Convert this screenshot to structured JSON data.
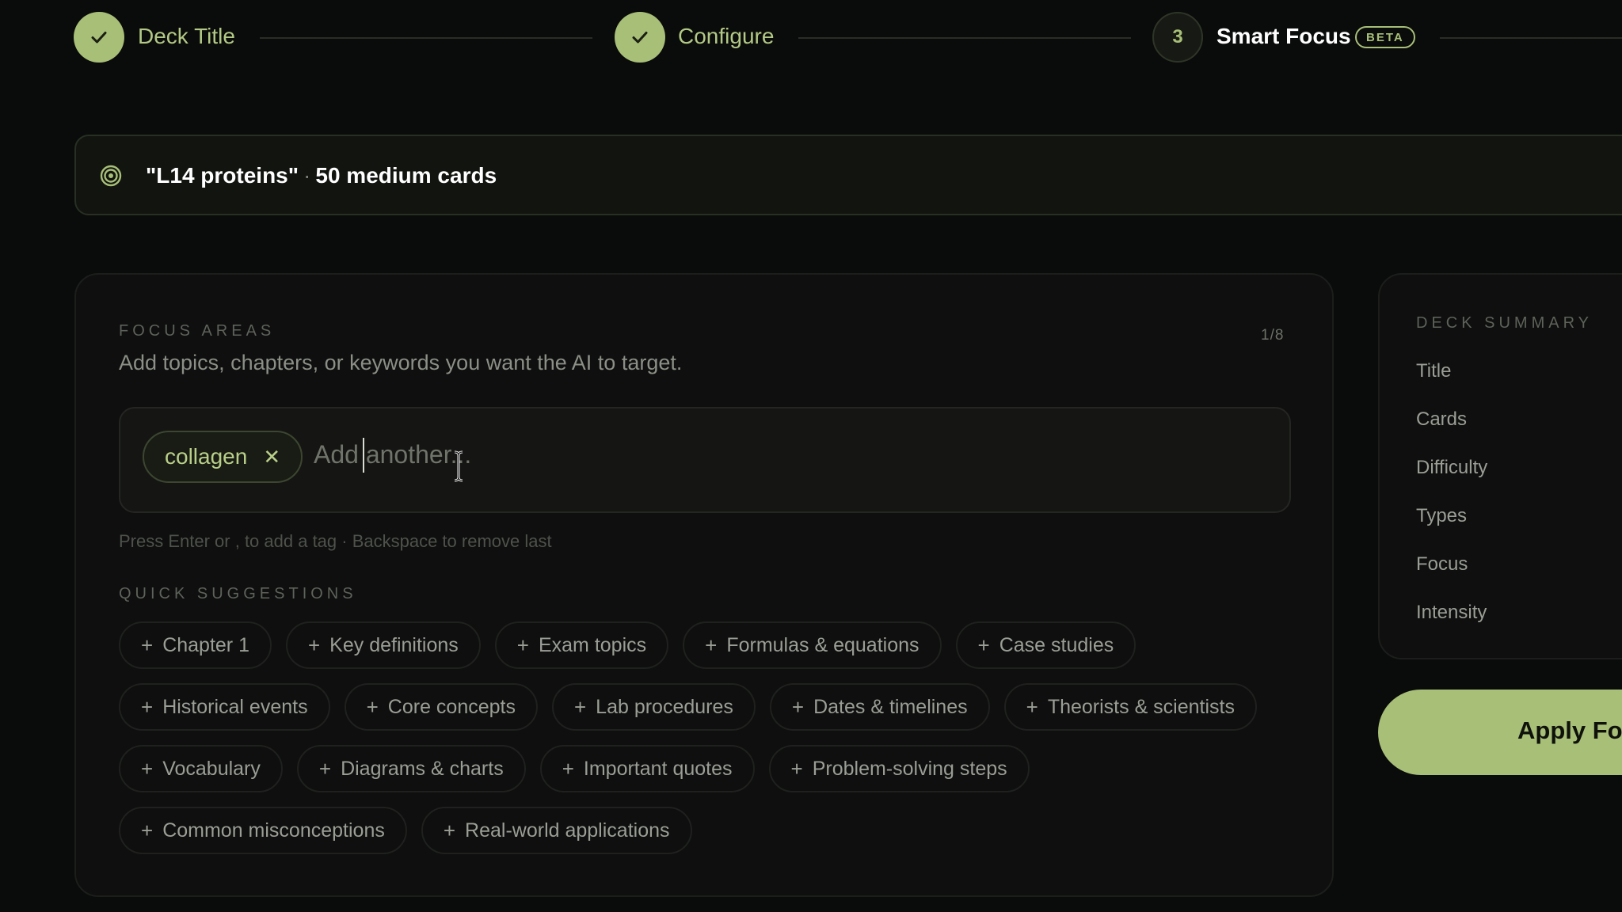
{
  "stepper": {
    "steps": [
      {
        "label": "Deck Title",
        "state": "done"
      },
      {
        "label": "Configure",
        "state": "done"
      },
      {
        "label": "Smart Focus",
        "number": "3",
        "state": "current",
        "badge": "BETA"
      }
    ]
  },
  "banner": {
    "icon": "target-icon",
    "deck_title": "\"L14 proteins\"",
    "separator": "·",
    "cards_text": "50 medium cards"
  },
  "focus": {
    "section_label": "FOCUS AREAS",
    "count": "1/8",
    "description": "Add topics, chapters, or keywords you want the AI to target.",
    "tags": [
      "collagen"
    ],
    "input_placeholder": "Add another...",
    "input_value": "",
    "hint": "Press Enter or , to add a tag · Backspace to remove last",
    "suggestions_label": "QUICK SUGGESTIONS",
    "suggestions": [
      "Chapter 1",
      "Key definitions",
      "Exam topics",
      "Formulas & equations",
      "Case studies",
      "Historical events",
      "Core concepts",
      "Lab procedures",
      "Dates & timelines",
      "Theorists & scientists",
      "Vocabulary",
      "Diagrams & charts",
      "Important quotes",
      "Problem-solving steps",
      "Common misconceptions",
      "Real-world applications"
    ]
  },
  "summary": {
    "section_label": "DECK SUMMARY",
    "rows": [
      "Title",
      "Cards",
      "Difficulty",
      "Types",
      "Focus",
      "Intensity"
    ]
  },
  "apply_button": {
    "label": "Apply Fo"
  },
  "colors": {
    "accent": "#a8bf78",
    "background": "#0a0b0b",
    "panel": "#0e0f0e"
  }
}
